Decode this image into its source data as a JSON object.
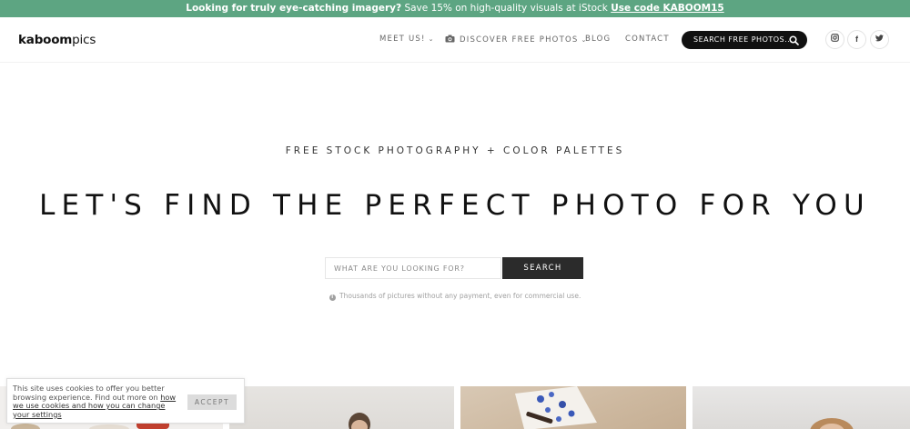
{
  "promo": {
    "lead": "Looking for truly eye-catching imagery?",
    "body": " Save 15% on high-quality visuals at iStock ",
    "link": "Use code KABOOM15",
    "background": "#5da582"
  },
  "header": {
    "logo_bold": "kaboom",
    "logo_light": "pics",
    "nav": {
      "meet_us": "MEET US!",
      "discover": "DISCOVER FREE PHOTOS",
      "blog": "BLOG",
      "contact": "CONTACT"
    },
    "search_button": "SEARCH FREE PHOTOS...",
    "social": {
      "instagram": "instagram-icon",
      "facebook": "f",
      "twitter": "twitter-icon"
    }
  },
  "hero": {
    "subtitle": "FREE STOCK PHOTOGRAPHY + COLOR PALETTES",
    "title": "LET'S FIND THE PERFECT PHOTO FOR YOU",
    "search_placeholder": "WHAT ARE YOU LOOKING FOR?",
    "search_button": "SEARCH",
    "note": "Thousands of pictures without any payment, even for commercial use."
  },
  "cookie": {
    "text": "This site uses cookies to offer you better browsing experience. Find out more on ",
    "link": "how we use cookies and how you can change your settings",
    "accept": "ACCEPT"
  },
  "icons": {
    "camera": "camera-icon",
    "search": "search-icon",
    "info": "info-icon",
    "chevron": "chevron-down-icon"
  }
}
